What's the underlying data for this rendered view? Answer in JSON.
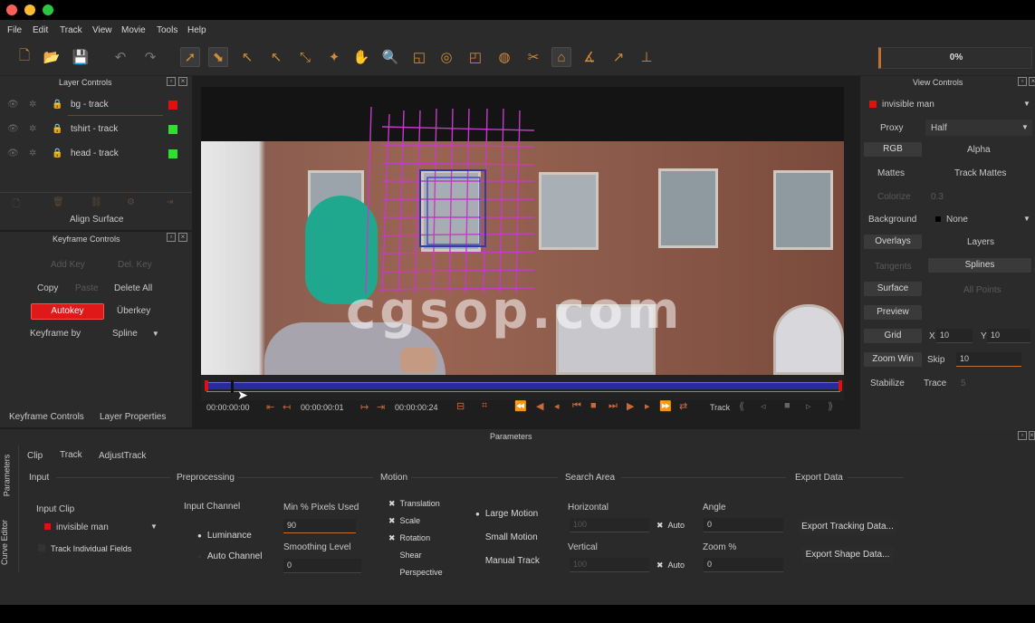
{
  "menu": [
    "File",
    "Edit",
    "Track",
    "View",
    "Movie",
    "Tools",
    "Help"
  ],
  "progress": "0%",
  "layer_controls": {
    "title": "Layer Controls",
    "layers": [
      {
        "name": "bg - track",
        "color": "#e01010"
      },
      {
        "name": "tshirt - track",
        "color": "#30e030"
      },
      {
        "name": "head - track",
        "color": "#30e030"
      }
    ],
    "align_surface": "Align Surface"
  },
  "keyframe_controls": {
    "title": "Keyframe Controls",
    "add_key": "Add Key",
    "del_key": "Del. Key",
    "copy": "Copy",
    "paste": "Paste",
    "delete_all": "Delete All",
    "autokey": "Autokey",
    "uberkey": "Überkey",
    "keyframe_by_label": "Keyframe by",
    "keyframe_by_value": "Spline"
  },
  "left_tabs": [
    "Keyframe Controls",
    "Layer Properties"
  ],
  "viewer": {
    "watermark": "cgsop.com"
  },
  "transport": {
    "time_start": "00:00:00:00",
    "time_current": "00:00:00:01",
    "time_end": "00:00:00:24",
    "track_label": "Track"
  },
  "view_controls": {
    "title": "View Controls",
    "clip": "invisible man",
    "proxy_label": "Proxy",
    "proxy_value": "Half",
    "rgb": "RGB",
    "alpha": "Alpha",
    "mattes": "Mattes",
    "track_mattes": "Track Mattes",
    "colorize": "Colorize",
    "colorize_value": "0.3",
    "background_label": "Background",
    "background_value": "None",
    "overlays": "Overlays",
    "layers": "Layers",
    "tangents": "Tangents",
    "splines": "Splines",
    "surface": "Surface",
    "all_points": "All Points",
    "preview": "Preview",
    "grid": "Grid",
    "grid_x_label": "X",
    "grid_x": "10",
    "grid_y_label": "Y",
    "grid_y": "10",
    "zoom_win": "Zoom Win",
    "skip_label": "Skip",
    "skip": "10",
    "stabilize": "Stabilize",
    "trace": "Trace",
    "trace_value": "5"
  },
  "parameters": {
    "title": "Parameters",
    "side_tabs": [
      "Parameters",
      "Curve Editor"
    ],
    "tabs": [
      "Clip",
      "Track",
      "AdjustTrack"
    ],
    "input": {
      "title": "Input",
      "clip_label": "Input Clip",
      "clip": "invisible man",
      "track_fields": "Track Individual Fields"
    },
    "preprocessing": {
      "title": "Preprocessing",
      "channel_label": "Input Channel",
      "luminance": "Luminance",
      "auto_channel": "Auto Channel",
      "min_pixels_label": "Min % Pixels Used",
      "min_pixels": "90",
      "smoothing_label": "Smoothing Level",
      "smoothing": "0"
    },
    "motion": {
      "title": "Motion",
      "translation": "Translation",
      "scale": "Scale",
      "rotation": "Rotation",
      "shear": "Shear",
      "perspective": "Perspective",
      "large_motion": "Large Motion",
      "small_motion": "Small Motion",
      "manual_track": "Manual Track"
    },
    "search_area": {
      "title": "Search Area",
      "horizontal_label": "Horizontal",
      "horizontal": "100",
      "vertical_label": "Vertical",
      "vertical": "100",
      "auto": "Auto",
      "angle_label": "Angle",
      "angle": "0",
      "zoom_label": "Zoom %",
      "zoom": "0"
    },
    "export": {
      "title": "Export Data",
      "tracking": "Export Tracking Data...",
      "shape": "Export Shape Data..."
    }
  }
}
